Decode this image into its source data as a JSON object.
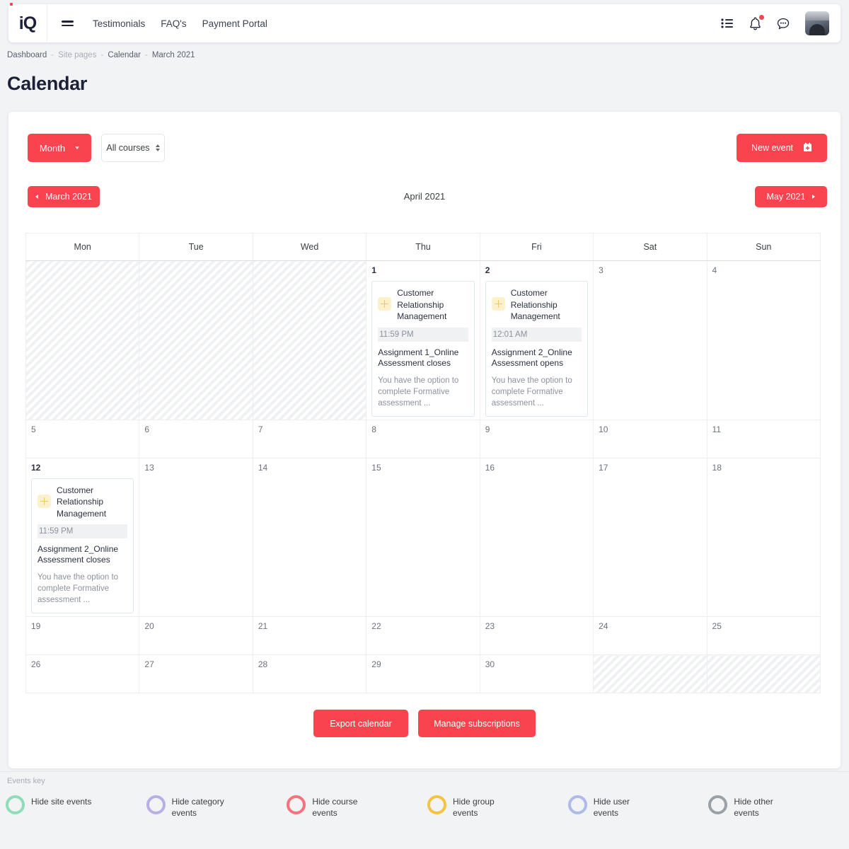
{
  "topbar": {
    "logo_text": "iQ",
    "menu_icon": "hamburger-icon",
    "nav": [
      {
        "label": "Testimonials"
      },
      {
        "label": "FAQ's"
      },
      {
        "label": "Payment Portal"
      }
    ],
    "icons": [
      {
        "name": "list-icon"
      },
      {
        "name": "bell-icon",
        "has_badge": true
      },
      {
        "name": "chat-icon"
      }
    ]
  },
  "breadcrumb": {
    "items": [
      "Dashboard",
      "Site pages",
      "Calendar",
      "March 2021"
    ],
    "separator": "-"
  },
  "page": {
    "title": "Calendar"
  },
  "toolbar": {
    "view_label": "Month",
    "course_filter": "All courses",
    "new_event_label": "New event",
    "new_event_icon": "calendar-plus-icon"
  },
  "navigation": {
    "prev_label": "March 2021",
    "current_label": "April 2021",
    "next_label": "May 2021"
  },
  "calendar": {
    "weekdays": [
      "Mon",
      "Tue",
      "Wed",
      "Thu",
      "Fri",
      "Sat",
      "Sun"
    ],
    "rows": [
      [
        {
          "hatched": true
        },
        {
          "hatched": true
        },
        {
          "hatched": true
        },
        {
          "day": "1",
          "event": {
            "course": "Customer Relationship Management",
            "time": "11:59 PM",
            "title": "Assignment 1_Online Assessment closes",
            "desc": "You have the option to complete Formative assessment ..."
          }
        },
        {
          "day": "2",
          "event": {
            "course": "Customer Relationship Management",
            "time": "12:01 AM",
            "title": "Assignment 2_Online Assessment opens",
            "desc": "You have the option to complete Formative assessment ..."
          }
        },
        {
          "day": "3"
        },
        {
          "day": "4"
        }
      ],
      [
        {
          "day": "5"
        },
        {
          "day": "6"
        },
        {
          "day": "7"
        },
        {
          "day": "8"
        },
        {
          "day": "9"
        },
        {
          "day": "10"
        },
        {
          "day": "11"
        }
      ],
      [
        {
          "day": "12",
          "event": {
            "course": "Customer Relationship Management",
            "time": "11:59 PM",
            "title": "Assignment 2_Online Assessment closes",
            "desc": "You have the option to complete Formative assessment ..."
          }
        },
        {
          "day": "13"
        },
        {
          "day": "14"
        },
        {
          "day": "15"
        },
        {
          "day": "16"
        },
        {
          "day": "17"
        },
        {
          "day": "18"
        }
      ],
      [
        {
          "day": "19"
        },
        {
          "day": "20"
        },
        {
          "day": "21"
        },
        {
          "day": "22"
        },
        {
          "day": "23"
        },
        {
          "day": "24"
        },
        {
          "day": "25"
        }
      ],
      [
        {
          "day": "26"
        },
        {
          "day": "27"
        },
        {
          "day": "28"
        },
        {
          "day": "29"
        },
        {
          "day": "30"
        },
        {
          "hatched": true
        },
        {
          "hatched": true
        }
      ]
    ]
  },
  "footer": {
    "export_label": "Export calendar",
    "subscriptions_label": "Manage subscriptions"
  },
  "events_key": {
    "label": "Events key",
    "items": [
      {
        "label": "Hide site events",
        "color": "#8fdcb8"
      },
      {
        "label": "Hide category events",
        "color": "#b9aee8"
      },
      {
        "label": "Hide course events",
        "color": "#f4737c"
      },
      {
        "label": "Hide group events",
        "color": "#f5c242"
      },
      {
        "label": "Hide user events",
        "color": "#aebbe8"
      },
      {
        "label": "Hide other events",
        "color": "#9aa0a8"
      }
    ]
  },
  "colors": {
    "accent": "#f9444f",
    "title": "#1b2138",
    "page_bg": "#f2f3f5"
  }
}
